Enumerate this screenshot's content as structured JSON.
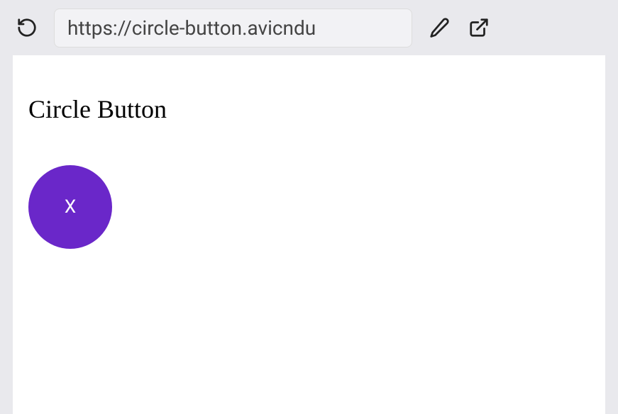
{
  "browser": {
    "url": "https://circle-button.avicndu"
  },
  "page": {
    "title": "Circle Button",
    "button_label": "X"
  }
}
